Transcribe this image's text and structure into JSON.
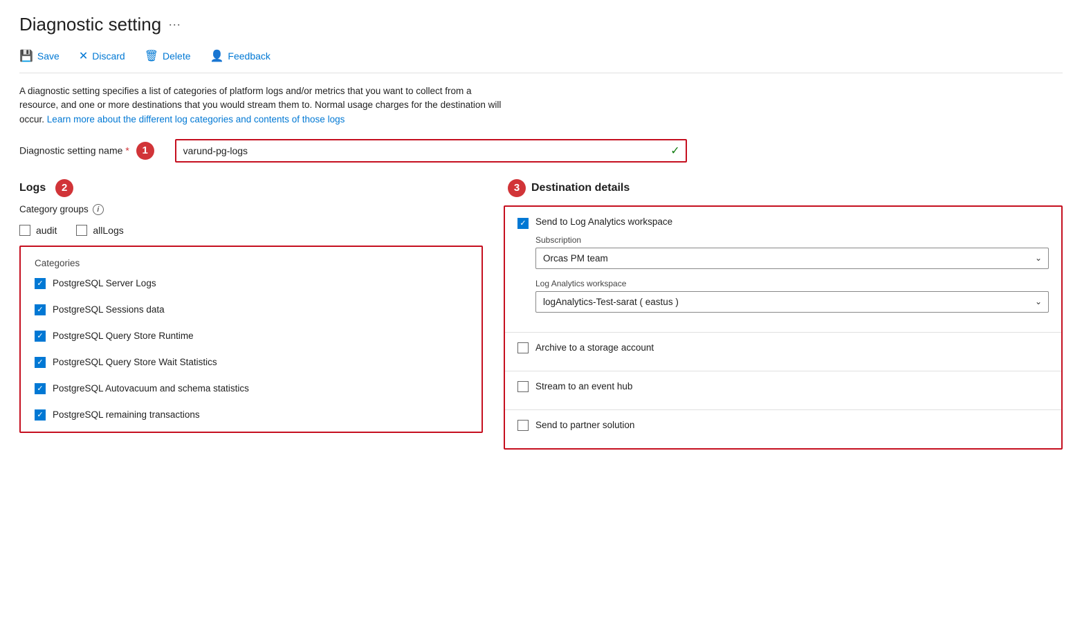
{
  "page": {
    "title": "Diagnostic setting",
    "ellipsis": "···"
  },
  "toolbar": {
    "save_label": "Save",
    "discard_label": "Discard",
    "delete_label": "Delete",
    "feedback_label": "Feedback"
  },
  "description": {
    "main_text": "A diagnostic setting specifies a list of categories of platform logs and/or metrics that you want to collect from a resource, and one or more destinations that you would stream them to. Normal usage charges for the destination will occur.",
    "link_text": "Learn more about the different log categories and contents of those logs"
  },
  "setting_name": {
    "label": "Diagnostic setting name",
    "step_badge": "1",
    "value": "varund-pg-logs",
    "placeholder": "Diagnostic setting name"
  },
  "logs_section": {
    "title": "Logs",
    "step_badge": "2",
    "category_groups_label": "Category groups",
    "audit_label": "audit",
    "allLogs_label": "allLogs",
    "categories_title": "Categories",
    "categories": [
      {
        "label": "PostgreSQL Server Logs",
        "checked": true
      },
      {
        "label": "PostgreSQL Sessions data",
        "checked": true
      },
      {
        "label": "PostgreSQL Query Store Runtime",
        "checked": true
      },
      {
        "label": "PostgreSQL Query Store Wait Statistics",
        "checked": true
      },
      {
        "label": "PostgreSQL Autovacuum and schema statistics",
        "checked": true
      },
      {
        "label": "PostgreSQL remaining transactions",
        "checked": true
      }
    ]
  },
  "destination_section": {
    "title": "Destination details",
    "step_badge": "3",
    "items": [
      {
        "type": "log_analytics",
        "label": "Send to Log Analytics workspace",
        "checked": true,
        "subscription_label": "Subscription",
        "subscription_value": "Orcas PM team",
        "workspace_label": "Log Analytics workspace",
        "workspace_value": "logAnalytics-Test-sarat ( eastus )"
      },
      {
        "type": "storage",
        "label": "Archive to a storage account",
        "checked": false
      },
      {
        "type": "event_hub",
        "label": "Stream to an event hub",
        "checked": false
      },
      {
        "type": "partner",
        "label": "Send to partner solution",
        "checked": false
      }
    ]
  }
}
